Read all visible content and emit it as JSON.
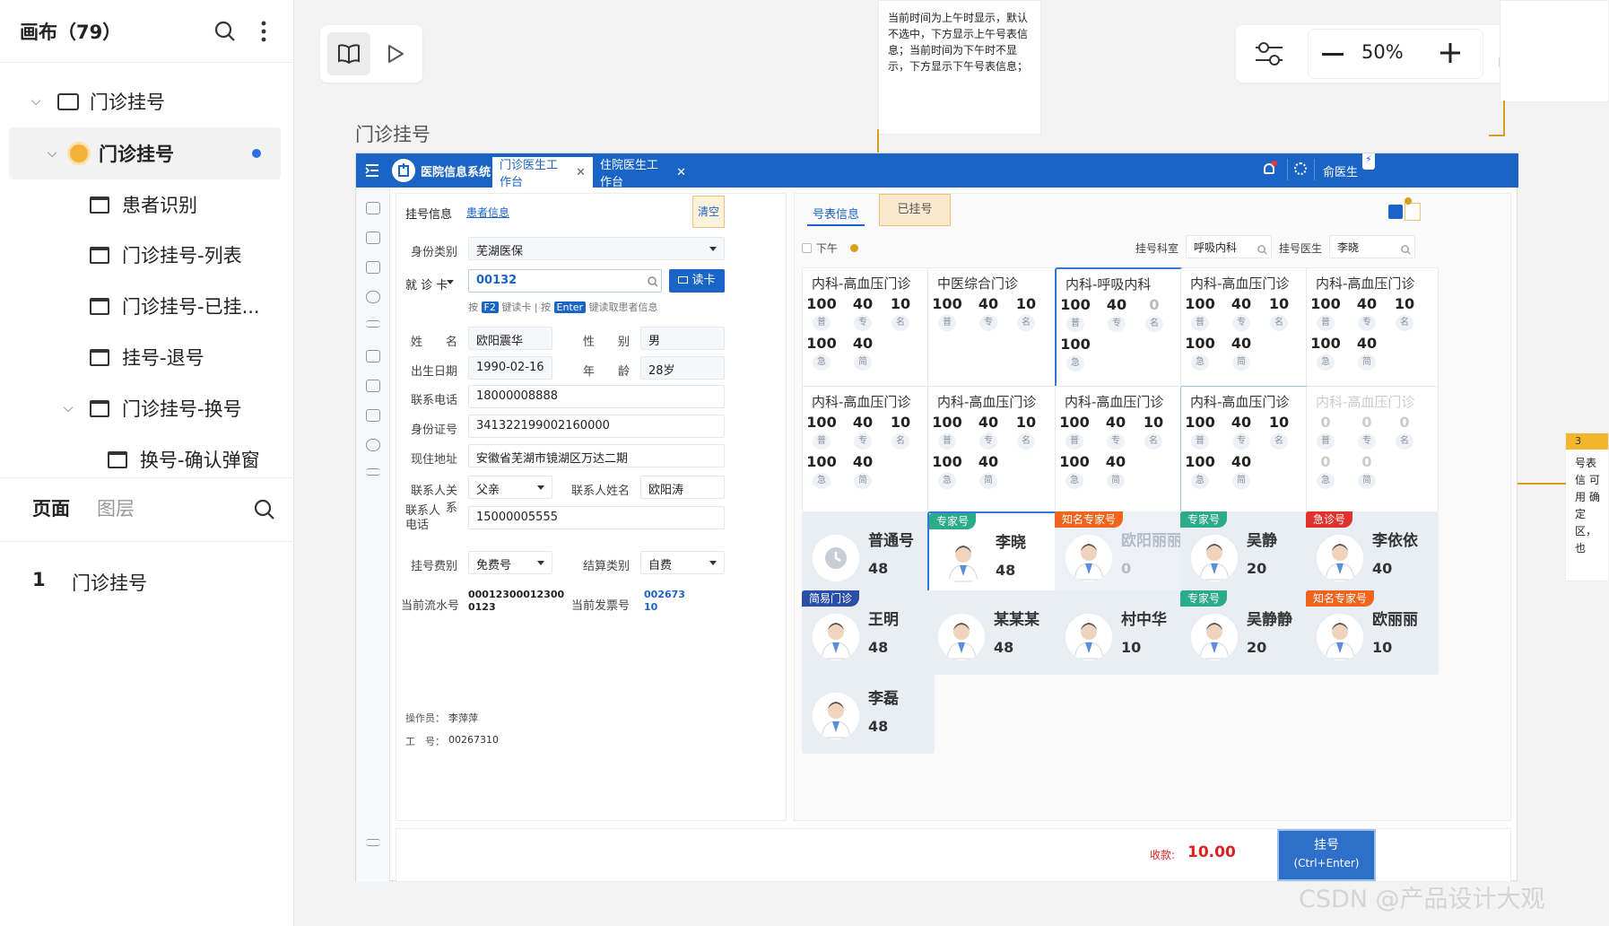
{
  "sidebar": {
    "title": "画布（79）",
    "tree": [
      {
        "label": "门诊挂号",
        "type": "folder"
      },
      {
        "label": "门诊挂号",
        "type": "page",
        "active": true
      },
      {
        "label": "患者识别"
      },
      {
        "label": "门诊挂号-列表"
      },
      {
        "label": "门诊挂号-已挂..."
      },
      {
        "label": "挂号-退号"
      },
      {
        "label": "门诊挂号-换号"
      },
      {
        "label": "换号-确认弹窗"
      }
    ],
    "tab_pages": "页面",
    "tab_layers": "图层",
    "page_list": [
      {
        "index": "1",
        "label": "门诊挂号"
      }
    ]
  },
  "toolbar": {
    "zoom": "50%"
  },
  "canvas": {
    "frame_title": "门诊挂号",
    "note_top": "当前时间为上午时显示，默认不选中，下方显示上午号表信息；当前时间为下午时不显示，下方显示下午号表信息；",
    "note_right_badge": "3",
    "note_right_text": "号表信 可用 确定 区，也"
  },
  "app": {
    "system_name": "医院信息系统",
    "tabs": [
      "门诊医生工作台",
      "住院医生工作台"
    ],
    "user": "俞医生",
    "form": {
      "tab_register": "挂号信息",
      "tab_patient": "患者信息",
      "clear": "清空",
      "id_type_label": "身份类别",
      "id_type": "芜湖医保",
      "card_type": "就 诊 卡",
      "card_no": "00132",
      "read_card": "读卡",
      "hint_1": "按",
      "hint_key1": "F2",
      "hint_2": "键读卡 | 按",
      "hint_key2": "Enter",
      "hint_3": "键读取患者信息",
      "name_label": "姓　　名",
      "name": "欧阳震华",
      "sex_label": "性　　别",
      "sex": "男",
      "dob_label": "出生日期",
      "dob": "1990-02-16",
      "age_label": "年　　龄",
      "age": "28岁",
      "phone_label": "联系电话",
      "phone": "18000008888",
      "idno_label": "身份证号",
      "idno": "341322199002160000",
      "addr_label": "现住地址",
      "addr": "安徽省芜湖市镜湖区万达二期",
      "rel_label": "联系人关系",
      "rel": "父亲",
      "contact_name_label": "联系人姓名",
      "contact_name": "欧阳涛",
      "contact_phone_label": "联系人电话",
      "contact_phone": "15000005555",
      "fee_type_label": "挂号费别",
      "fee_type": "免费号",
      "settle_label": "结算类别",
      "settle": "自费",
      "serial_label": "当前流水号",
      "serial": "000123000123000123",
      "invoice_label": "当前发票号",
      "invoice": "00267310",
      "operator_label": "操作员：",
      "operator": "李萍萍",
      "staff_label": "工　号：",
      "staff_no": "00267310"
    },
    "grid": {
      "tab_schedule": "号表信息",
      "tab_registered": "已挂号",
      "afternoon": "下午",
      "dept_label": "挂号科室",
      "dept": "呼吸内科",
      "doctor_label": "挂号医生",
      "doctor": "李晓",
      "chip_labels": [
        "普",
        "专",
        "名",
        "急",
        "简"
      ],
      "clinics": [
        {
          "name": "内科-高血压门诊",
          "v": [
            "100",
            "40",
            "10",
            "100",
            "40"
          ]
        },
        {
          "name": "中医综合门诊",
          "v": [
            "100",
            "40",
            "10",
            "",
            ""
          ]
        },
        {
          "name": "内科-呼吸内科",
          "v": [
            "100",
            "40",
            "0",
            "100",
            ""
          ]
        },
        {
          "name": "内科-高血压门诊",
          "v": [
            "100",
            "40",
            "10",
            "100",
            "40"
          ]
        },
        {
          "name": "内科-高血压门诊",
          "v": [
            "100",
            "40",
            "10",
            "100",
            "40"
          ]
        },
        {
          "name": "内科-高血压门诊",
          "v": [
            "100",
            "40",
            "10",
            "100",
            "40"
          ]
        },
        {
          "name": "内科-高血压门诊",
          "v": [
            "100",
            "40",
            "10",
            "100",
            "40"
          ]
        },
        {
          "name": "内科-高血压门诊",
          "v": [
            "100",
            "40",
            "10",
            "100",
            "40"
          ]
        },
        {
          "name": "内科-高血压门诊",
          "v": [
            "100",
            "40",
            "10",
            "100",
            "40"
          ]
        },
        {
          "name": "内科-高血压门诊",
          "v": [
            "0",
            "0",
            "0",
            "0",
            "0"
          ]
        }
      ],
      "doctors": [
        {
          "badge": "",
          "name": "普通号",
          "count": "48"
        },
        {
          "badge": "专家号",
          "name": "李晓",
          "count": "48"
        },
        {
          "badge": "知名专家号",
          "name": "欧阳丽丽",
          "count": "0"
        },
        {
          "badge": "专家号",
          "name": "吴静",
          "count": "20"
        },
        {
          "badge": "急诊号",
          "name": "李依依",
          "count": "40"
        },
        {
          "badge": "简易门诊",
          "name": "王明",
          "count": "48"
        },
        {
          "badge": "",
          "name": "某某某",
          "count": "48"
        },
        {
          "badge": "",
          "name": "村中华",
          "count": "10"
        },
        {
          "badge": "专家号",
          "name": "吴静静",
          "count": "20"
        },
        {
          "badge": "知名专家号",
          "name": "欧丽丽",
          "count": "10"
        },
        {
          "badge": "",
          "name": "李磊",
          "count": "48"
        }
      ],
      "badge_colors": {
        "专家号": "#2bab8a",
        "知名专家号": "#f0641e",
        "急诊号": "#e0312d",
        "简易门诊": "#2b4ea8"
      }
    },
    "bottom": {
      "fee_label": "收款:",
      "fee": "10.00",
      "register": "挂号",
      "register_hint": "(Ctrl+Enter)"
    }
  },
  "watermark": "CSDN @产品设计大观",
  "colors": {
    "primary": "#1a64c6",
    "accent_orange": "#e8a020",
    "fee_red": "#e02020"
  }
}
